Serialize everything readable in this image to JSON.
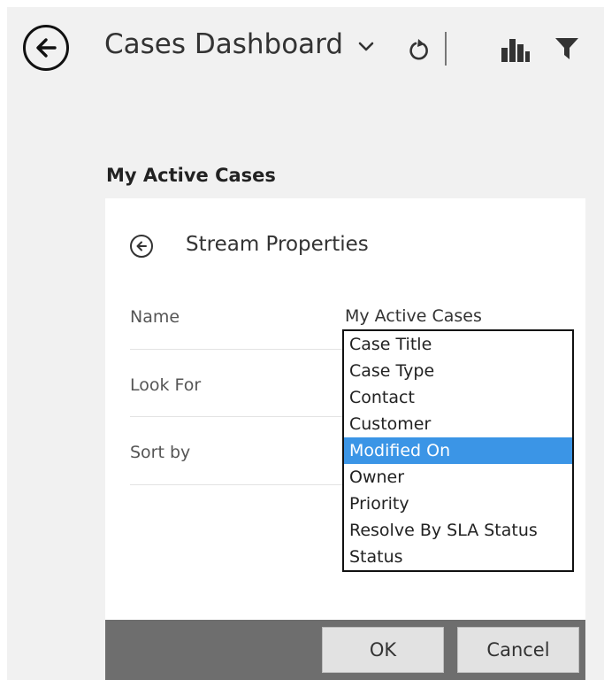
{
  "header": {
    "title": "Cases Dashboard",
    "icons": [
      "back-arrow-icon",
      "chevron-down-icon",
      "refresh-icon",
      "bar-chart-icon",
      "filter-icon"
    ]
  },
  "section": {
    "title": "My Active Cases"
  },
  "panel": {
    "title": "Stream Properties",
    "name_label": "Name",
    "name_value": "My Active Cases",
    "look_for_label": "Look For",
    "sort_by_label": "Sort by"
  },
  "sort_options": {
    "items": [
      "Case Title",
      "Case Type",
      "Contact",
      "Customer",
      "Modified On",
      "Owner",
      "Priority",
      "Resolve By SLA Status",
      "Status"
    ],
    "selected": "Modified On"
  },
  "footer": {
    "ok_label": "OK",
    "cancel_label": "Cancel"
  },
  "colors": {
    "selection": "#3b95e6",
    "footer_bar": "#6e6e6e",
    "page_bg": "#f1f1f1"
  }
}
